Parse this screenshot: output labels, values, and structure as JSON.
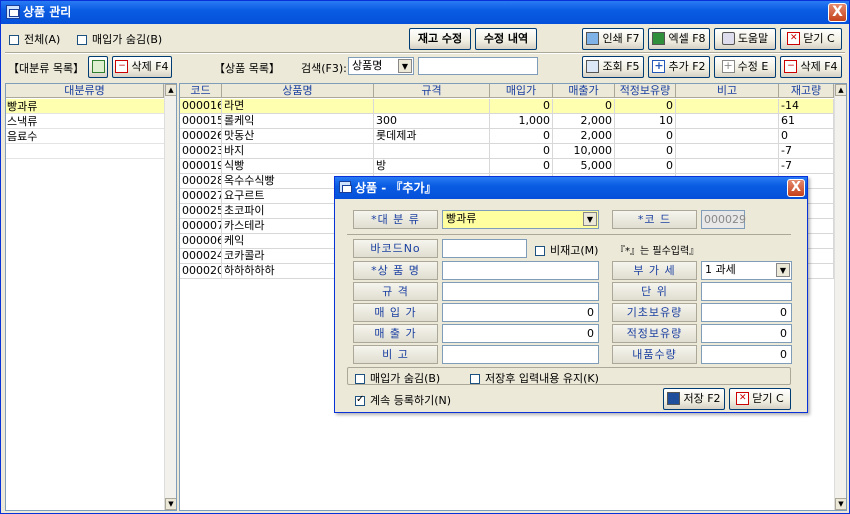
{
  "window": {
    "title": "상품 관리",
    "close": "X"
  },
  "toolbar": {
    "all_check": "전체(A)",
    "hide_cost_check": "매입가 숨김(B)",
    "stock_edit": "재고 수정",
    "edit_history": "수정 내역",
    "print": "인쇄 F7",
    "excel": "엑셀 F8",
    "help": "도움말",
    "close": "닫기 C"
  },
  "category_panel": {
    "title": "【대분류 목록】",
    "delete": "삭제 F4",
    "header": "대분류명",
    "items": [
      "빵과류",
      "스낵류",
      "음료수"
    ]
  },
  "product_panel": {
    "title": "【상품 목록】",
    "search_label": "검색(F3):",
    "search_type": "상품명",
    "search_value": "",
    "view": "조회 F5",
    "add": "추가 F2",
    "edit": "수정 E",
    "delete": "삭제 F4",
    "headers": [
      "코드",
      "상품명",
      "규격",
      "매입가",
      "매출가",
      "적정보유량",
      "비고",
      "재고량"
    ],
    "rows": [
      {
        "code": "000016",
        "name": "라면",
        "spec": "",
        "cost": "0",
        "price": "0",
        "safe": "0",
        "note": "",
        "stock": "-14"
      },
      {
        "code": "000015",
        "name": "롤케익",
        "spec": "300",
        "cost": "1,000",
        "price": "2,000",
        "safe": "10",
        "note": "",
        "stock": "61"
      },
      {
        "code": "000026",
        "name": "맛동산",
        "spec": "롯데제과",
        "cost": "0",
        "price": "2,000",
        "safe": "0",
        "note": "",
        "stock": "0"
      },
      {
        "code": "000023",
        "name": "바지",
        "spec": "",
        "cost": "0",
        "price": "10,000",
        "safe": "0",
        "note": "",
        "stock": "-7"
      },
      {
        "code": "000019",
        "name": "식빵",
        "spec": "방",
        "cost": "0",
        "price": "5,000",
        "safe": "0",
        "note": "",
        "stock": "-7"
      },
      {
        "code": "000028",
        "name": "옥수수식빵",
        "spec": "",
        "cost": "",
        "price": "",
        "safe": "",
        "note": "",
        "stock": ""
      },
      {
        "code": "000027",
        "name": "요구르트",
        "spec": "",
        "cost": "",
        "price": "",
        "safe": "",
        "note": "",
        "stock": ""
      },
      {
        "code": "000025",
        "name": "초코파이",
        "spec": "",
        "cost": "",
        "price": "",
        "safe": "",
        "note": "",
        "stock": ""
      },
      {
        "code": "000007",
        "name": "카스테라",
        "spec": "",
        "cost": "",
        "price": "",
        "safe": "",
        "note": "",
        "stock": ""
      },
      {
        "code": "000006",
        "name": "케익",
        "spec": "",
        "cost": "",
        "price": "",
        "safe": "",
        "note": "",
        "stock": ""
      },
      {
        "code": "000024",
        "name": "코카콜라",
        "spec": "",
        "cost": "",
        "price": "",
        "safe": "",
        "note": "",
        "stock": ""
      },
      {
        "code": "000020",
        "name": "하하하하하",
        "spec": "",
        "cost": "",
        "price": "",
        "safe": "",
        "note": "",
        "stock": ""
      }
    ]
  },
  "dialog": {
    "title": "상품 - 『추가』",
    "close": "X",
    "category_label": "*대 분 류",
    "category_value": "빵과류",
    "code_label": "*코    드",
    "code_value": "000029",
    "barcode_label": "바코드No",
    "barcode_value": "",
    "non_stock_check": "비재고(M)",
    "required_note": "『*』는 필수입력』",
    "name_label": "*상 품 명",
    "tax_label": "부 가 세",
    "tax_value": "1 과세",
    "spec_label": "규    격",
    "unit_label": "단    위",
    "cost_label": "매 입 가",
    "cost_value": "0",
    "init_stock_label": "기초보유량",
    "init_stock_value": "0",
    "price_label": "매 출 가",
    "price_value": "0",
    "safe_stock_label": "적정보유량",
    "safe_stock_value": "0",
    "note_label": "비    고",
    "return_label": "내품수량",
    "return_value": "0",
    "hide_cost_check": "매입가 숨김(B)",
    "keep_input_check": "저장후 입력내용 유지(K)",
    "continue_check": "계속 등록하기(N)",
    "save": "저장 F2",
    "close_btn": "닫기 C"
  }
}
